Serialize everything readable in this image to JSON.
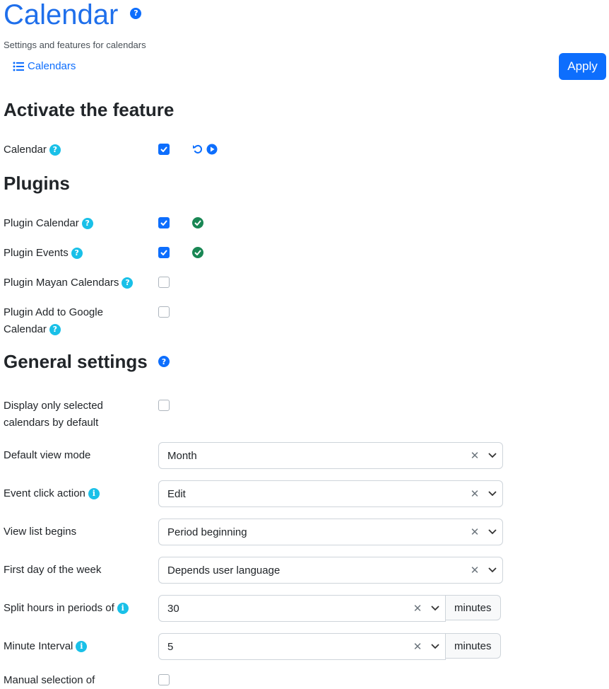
{
  "header": {
    "title": "Calendar",
    "title_help": "?",
    "subtitle": "Settings and features for calendars",
    "breadcrumb_label": "Calendars",
    "apply_label": "Apply"
  },
  "sections": {
    "activate": "Activate the feature",
    "plugins": "Plugins",
    "general": "General settings"
  },
  "help_glyph": "?",
  "info_glyph": "i",
  "activate": {
    "calendar_label": "Calendar",
    "calendar_checked": true
  },
  "plugins": [
    {
      "label": "Plugin Calendar",
      "checked": true,
      "status": "ok"
    },
    {
      "label": "Plugin Events",
      "checked": true,
      "status": "ok"
    },
    {
      "label": "Plugin Mayan Calendars",
      "checked": false
    },
    {
      "label_line1": "Plugin Add to Google",
      "label_line2": "Calendar",
      "checked": false
    }
  ],
  "general": {
    "display_selected_line1": "Display only selected",
    "display_selected_line2": "calendars by default",
    "display_selected_checked": false,
    "default_view_label": "Default view mode",
    "default_view_value": "Month",
    "event_click_label": "Event click action",
    "event_click_value": "Edit",
    "view_list_label": "View list begins",
    "view_list_value": "Period beginning",
    "first_day_label": "First day of the week",
    "first_day_value": "Depends user language",
    "split_hours_label": "Split hours in periods of",
    "split_hours_value": "30",
    "split_hours_unit": "minutes",
    "minute_interval_label": "Minute Interval",
    "minute_interval_value": "5",
    "minute_interval_unit": "minutes",
    "manual_selection_label": "Manual selection of",
    "manual_selection_checked": false
  },
  "colors": {
    "accent": "#0d6efd",
    "help": "#19c0e8",
    "success": "#198754"
  }
}
